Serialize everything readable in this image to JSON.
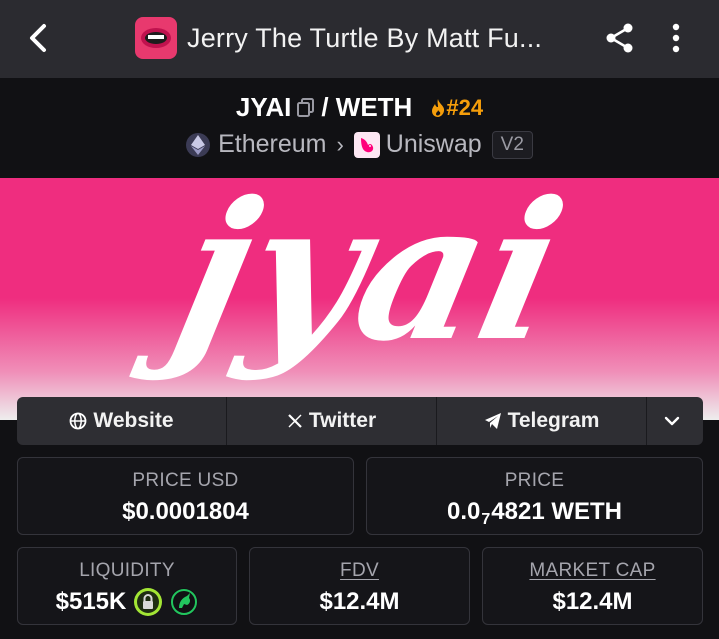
{
  "appbar": {
    "title": "Jerry The Turtle By Matt Fu..."
  },
  "pair": {
    "base": "JYAI",
    "separator": "/ WETH",
    "rank": "#24",
    "chain": "Ethereum",
    "dex": "Uniswap",
    "version": "V2"
  },
  "banner": {
    "logo_text": "jyai"
  },
  "links": [
    {
      "label": "Website",
      "icon": "globe-icon"
    },
    {
      "label": "Twitter",
      "icon": "x-icon"
    },
    {
      "label": "Telegram",
      "icon": "telegram-icon"
    }
  ],
  "stats": {
    "price_usd": {
      "label": "PRICE USD",
      "value": "$0.0001804"
    },
    "price": {
      "label": "PRICE",
      "prefix": "0.0",
      "subscript": "7",
      "suffix": "4821 WETH"
    },
    "liquidity": {
      "label": "LIQUIDITY",
      "value": "$515K"
    },
    "fdv": {
      "label": "FDV",
      "value": "$12.4M"
    },
    "market_cap": {
      "label": "MARKET CAP",
      "value": "$12.4M"
    }
  },
  "colors": {
    "banner_pink": "#ef2d7f",
    "rank_orange": "#f59e0b",
    "lock_green": "#a3e635",
    "uni_green": "#22c55e"
  }
}
